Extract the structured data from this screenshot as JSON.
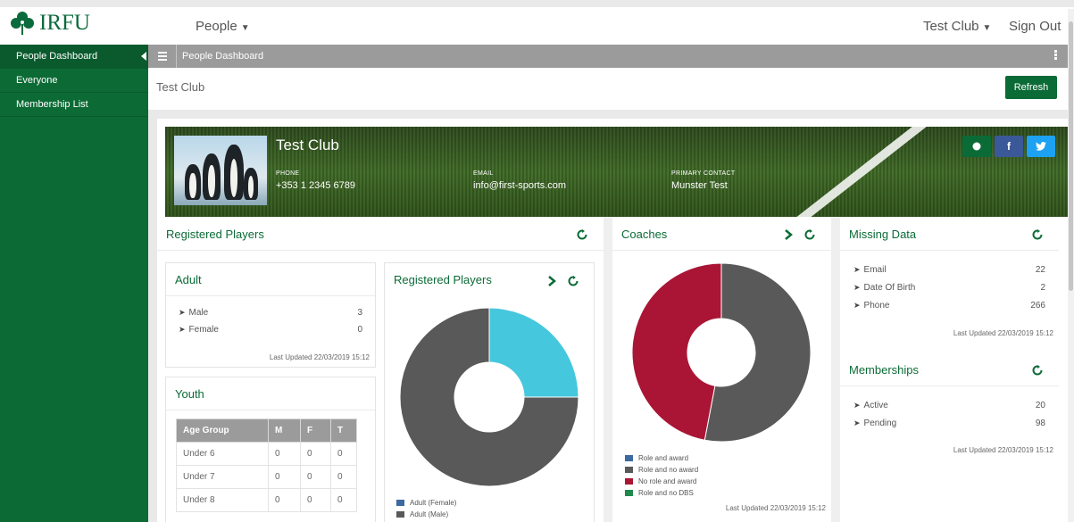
{
  "brand": {
    "name": "IRFU",
    "logo_icon": "shamrock-icon",
    "color": "#0a6b3c"
  },
  "topnav": {
    "section": "People",
    "club": "Test Club",
    "sign_out": "Sign Out"
  },
  "sidebar": {
    "items": [
      {
        "label": "People Dashboard",
        "active": true
      },
      {
        "label": "Everyone"
      },
      {
        "label": "Membership List"
      }
    ]
  },
  "pagebar": {
    "title": "People Dashboard"
  },
  "clubbar": {
    "name": "Test Club",
    "refresh": "Refresh"
  },
  "hero": {
    "club_name": "Test Club",
    "phone_label": "PHONE",
    "phone": "+353 1 2345 6789",
    "email_label": "EMAIL",
    "email": "info@first-sports.com",
    "contact_label": "PRIMARY CONTACT",
    "contact": "Munster Test",
    "social": {
      "facebook": "f",
      "twitter": "t"
    }
  },
  "registered_players": {
    "title": "Registered Players",
    "adult": {
      "title": "Adult",
      "rows": [
        {
          "label": "Male",
          "value": "3"
        },
        {
          "label": "Female",
          "value": "0"
        }
      ],
      "updated": "Last Updated 22/03/2019 15:12"
    },
    "youth": {
      "title": "Youth",
      "headers": [
        "Age Group",
        "M",
        "F",
        "T"
      ],
      "rows": [
        [
          "Under 6",
          "0",
          "0",
          "0"
        ],
        [
          "Under 7",
          "0",
          "0",
          "0"
        ],
        [
          "Under 8",
          "0",
          "0",
          "0"
        ]
      ]
    },
    "chart_card_title": "Registered Players"
  },
  "coaches": {
    "title": "Coaches",
    "updated": "Last Updated 22/03/2019 15:12"
  },
  "missing_data": {
    "title": "Missing Data",
    "rows": [
      {
        "label": "Email",
        "value": "22"
      },
      {
        "label": "Date Of Birth",
        "value": "2"
      },
      {
        "label": "Phone",
        "value": "266"
      }
    ],
    "updated": "Last Updated 22/03/2019 15:12"
  },
  "memberships": {
    "title": "Memberships",
    "rows": [
      {
        "label": "Active",
        "value": "20"
      },
      {
        "label": "Pending",
        "value": "98"
      }
    ],
    "updated": "Last Updated 22/03/2019 15:12"
  },
  "chart_data": [
    {
      "type": "pie",
      "categories": [
        "Adult (Female)",
        "Adult (Male)"
      ],
      "values": [
        25,
        75
      ],
      "colors": [
        "#45c7de",
        "#595959"
      ]
    },
    {
      "type": "pie",
      "categories": [
        "Role and award",
        "Role and no award",
        "No role and award",
        "Role and no DBS"
      ],
      "values": [
        0,
        53,
        47,
        0
      ],
      "colors": [
        "#3b6aa0",
        "#595959",
        "#aa1535",
        "#1f8a4c"
      ]
    }
  ]
}
